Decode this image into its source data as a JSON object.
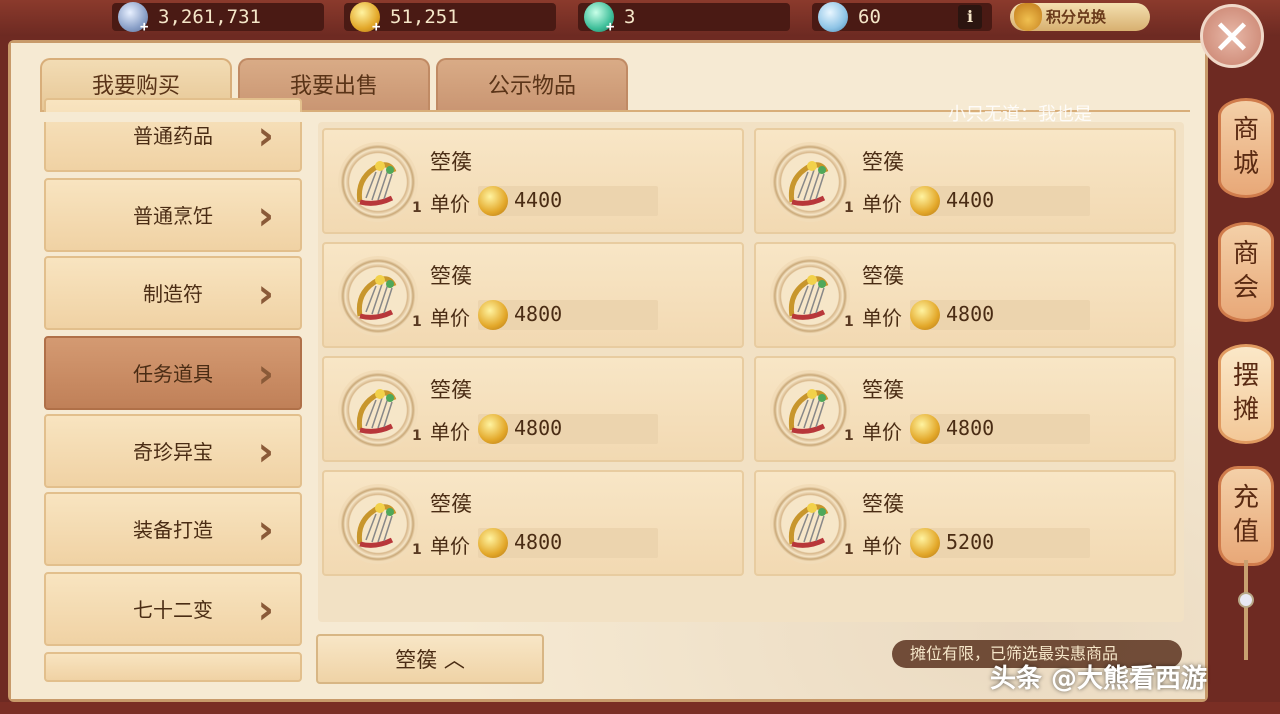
{
  "currency": {
    "silver": "3,261,731",
    "gold": "51,251",
    "jade": "3",
    "ingot": "60",
    "info_label": "i",
    "points_exchange": "积分兑换"
  },
  "tabs": [
    {
      "label": "我要购买",
      "active": true
    },
    {
      "label": "我要出售",
      "active": false
    },
    {
      "label": "公示物品",
      "active": false
    }
  ],
  "notice": "小只无道：我也是",
  "categories": [
    {
      "label": "普通药品",
      "active": false
    },
    {
      "label": "普通烹饪",
      "active": false
    },
    {
      "label": "制造符",
      "active": false
    },
    {
      "label": "任务道具",
      "active": true
    },
    {
      "label": "奇珍异宝",
      "active": false
    },
    {
      "label": "装备打造",
      "active": false
    },
    {
      "label": "七十二变",
      "active": false
    }
  ],
  "items": [
    {
      "name": "箜篌",
      "price_label": "单价",
      "price": "4400",
      "qty": "1"
    },
    {
      "name": "箜篌",
      "price_label": "单价",
      "price": "4400",
      "qty": "1"
    },
    {
      "name": "箜篌",
      "price_label": "单价",
      "price": "4800",
      "qty": "1"
    },
    {
      "name": "箜篌",
      "price_label": "单价",
      "price": "4800",
      "qty": "1"
    },
    {
      "name": "箜篌",
      "price_label": "单价",
      "price": "4800",
      "qty": "1"
    },
    {
      "name": "箜篌",
      "price_label": "单价",
      "price": "4800",
      "qty": "1"
    },
    {
      "name": "箜篌",
      "price_label": "单价",
      "price": "4800",
      "qty": "1"
    },
    {
      "name": "箜篌",
      "price_label": "单价",
      "price": "5200",
      "qty": "1"
    }
  ],
  "filter_button": "箜篌",
  "hint": "摊位有限，已筛选最实惠商品",
  "watermark": "头条 @大熊看西游",
  "side_nav": [
    {
      "label": "商城",
      "active": false
    },
    {
      "label": "商会",
      "active": false
    },
    {
      "label": "摆摊",
      "active": true
    },
    {
      "label": "充值",
      "active": false
    }
  ],
  "colors": {
    "accent": "#c08058",
    "panel": "#f6ead3",
    "frame": "#6e2a22"
  }
}
